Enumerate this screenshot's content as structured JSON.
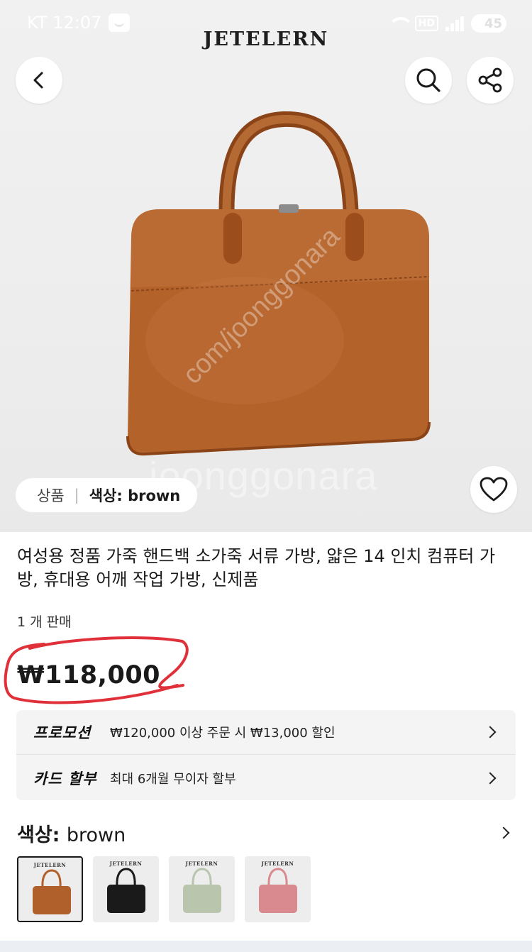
{
  "status_bar": {
    "carrier_time": "KT 12:07",
    "network_badge": "HD",
    "battery_level": "45"
  },
  "header": {
    "brand": "JETELERN",
    "back_icon": "chevron-left-icon",
    "search_icon": "search-icon",
    "share_icon": "share-icon"
  },
  "hero": {
    "watermark_url": "com/joonggonara",
    "watermark_text": "joonggonara",
    "chip": {
      "product_label": "상품",
      "separator": "|",
      "color_label": "색상: brown"
    },
    "favorite_icon": "heart-icon"
  },
  "product": {
    "title": "여성용 정품 가죽 핸드백 소가죽 서류 가방, 얇은 14 인치 컴퓨터 가방, 휴대용 어깨 작업 가방, 신제품",
    "sold_count": "1 개 판매",
    "price": "₩118,000",
    "annotation_color": "#e0303a"
  },
  "promotions": [
    {
      "label": "프로모션",
      "text": "₩120,000 이상 주문 시 ₩13,000 할인"
    },
    {
      "label": "카드 할부",
      "text": "최대 6개월 무이자 할부"
    }
  ],
  "color_section": {
    "label_prefix": "색상: ",
    "selected_color": "brown",
    "options": [
      {
        "name": "brown",
        "hex": "#b0602a",
        "logo": "JETELERN",
        "selected": true
      },
      {
        "name": "black",
        "hex": "#1a1a1a",
        "logo": "JETELERN",
        "selected": false
      },
      {
        "name": "sage",
        "hex": "#b9c5ad",
        "logo": "JETELERN",
        "selected": false
      },
      {
        "name": "pink",
        "hex": "#d88a8e",
        "logo": "JETELERN",
        "selected": false
      }
    ]
  }
}
